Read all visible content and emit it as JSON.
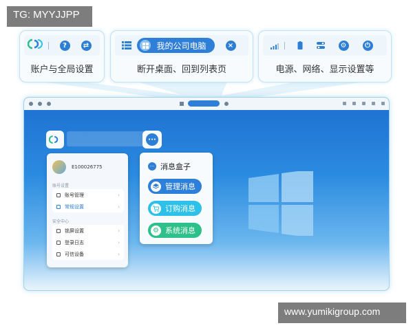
{
  "watermarks": {
    "top_left": "TG: MYYJJPP",
    "bottom_right": "www.yumikigroup.com"
  },
  "callouts": [
    {
      "caption": "账户与全局设置",
      "icons": [
        "app-logo-icon",
        "help-icon",
        "refresh-icon"
      ]
    },
    {
      "caption": "断开桌面、回到列表页",
      "icons": [
        "list-icon",
        "windows-icon",
        "close-icon"
      ],
      "pill_label": "我的公司电脑"
    },
    {
      "caption": "电源、网络、显示设置等",
      "icons": [
        "signal-icon",
        "battery-icon",
        "toggle-icon",
        "gear-icon",
        "power-icon"
      ]
    }
  ],
  "account_panel": {
    "user_id": "E100026775",
    "group1_label": "账号设置",
    "group1_items": [
      "账号管理",
      "常规设置"
    ],
    "group2_label": "安全中心",
    "group2_items": [
      "锁屏设置",
      "登录日志",
      "可信设备"
    ]
  },
  "message_panel": {
    "title": "消息盒子",
    "buttons": [
      "管理消息",
      "订购消息",
      "系统消息"
    ]
  },
  "colors": {
    "accent": "#2f7fd8",
    "cyan": "#2ec0e8",
    "green": "#2ec08a",
    "desktop_top": "#1d6fd0"
  }
}
